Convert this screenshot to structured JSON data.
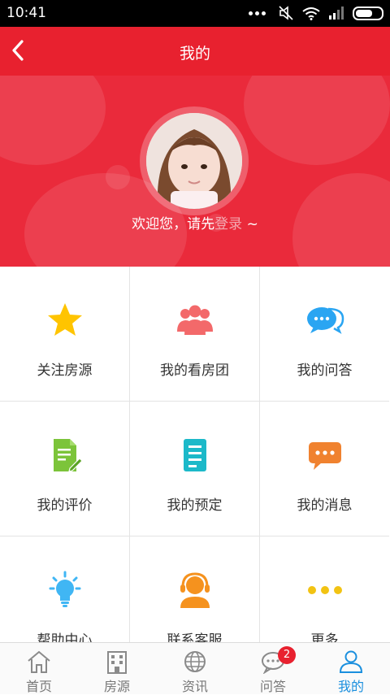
{
  "status_bar": {
    "time": "10:41"
  },
  "header": {
    "title": "我的"
  },
  "profile": {
    "welcome_prefix": "欢迎您，请先",
    "login_link": "登录",
    "welcome_suffix": " ~"
  },
  "grid": {
    "items": [
      {
        "label": "关注房源",
        "icon": "star-icon",
        "color": "#ffc400"
      },
      {
        "label": "我的看房团",
        "icon": "group-icon",
        "color": "#f3696a"
      },
      {
        "label": "我的问答",
        "icon": "chat-bubbles-icon",
        "color": "#2aa5f2"
      },
      {
        "label": "我的评价",
        "icon": "document-edit-icon",
        "color": "#7cc43a"
      },
      {
        "label": "我的预定",
        "icon": "list-doc-icon",
        "color": "#1cb9c9"
      },
      {
        "label": "我的消息",
        "icon": "message-icon",
        "color": "#f0822f"
      },
      {
        "label": "帮助中心",
        "icon": "lightbulb-icon",
        "color": "#40b6f4"
      },
      {
        "label": "联系客服",
        "icon": "customer-service-icon",
        "color": "#f5921e"
      },
      {
        "label": "更多",
        "icon": "more-dots-icon",
        "color": "#f2c313"
      }
    ]
  },
  "tabbar": {
    "tabs": [
      {
        "label": "首页",
        "icon": "home-icon"
      },
      {
        "label": "房源",
        "icon": "building-icon"
      },
      {
        "label": "资讯",
        "icon": "globe-icon"
      },
      {
        "label": "问答",
        "icon": "chat-icon",
        "badge": "2"
      },
      {
        "label": "我的",
        "icon": "user-icon",
        "active": true
      }
    ]
  },
  "colors": {
    "brand_red": "#e8212f",
    "active_tab": "#1a8fde"
  }
}
